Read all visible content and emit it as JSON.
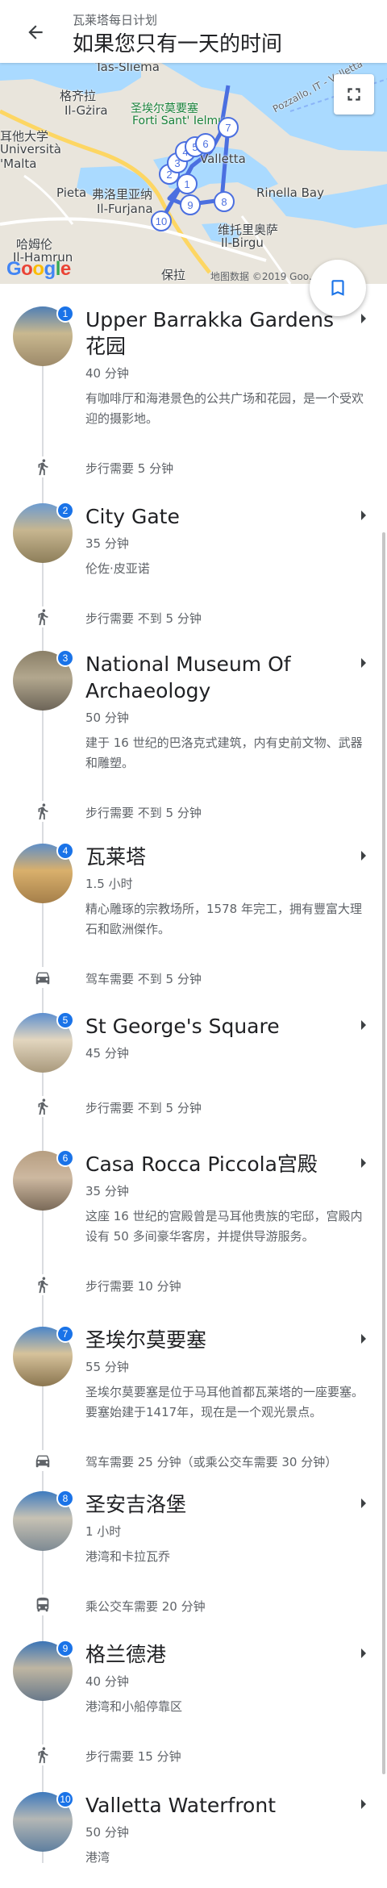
{
  "header": {
    "subtitle": "瓦莱塔每日计划",
    "title": "如果您只有一天的时间"
  },
  "map": {
    "labels": {
      "tas_sliema": "Tas-Sliema",
      "gzira_cn": "格齐拉",
      "gzira": "Il-Gżira",
      "uni_cn": "耳他大学",
      "uni1": "Università",
      "uni2": "'Malta",
      "fort_cn": "圣埃尔莫要塞",
      "fort": "Forti Sant' Ielmu",
      "valletta": "Valletta",
      "pieta": "Pieta",
      "furjana_cn": "弗洛里亚纳",
      "furjana": "Il-Furjana",
      "rinella": "Rinella Bay",
      "birgu_cn": "维托里奥萨",
      "birgu": "Il-Birgu",
      "hamrun_cn": "哈姆伦",
      "hamrun": "Il-Hamrun",
      "paola": "保拉",
      "pozzallo": "Pozzallo, IT - Valletta"
    },
    "markers": [
      "1",
      "2",
      "3",
      "4",
      "5",
      "6",
      "7",
      "8",
      "9",
      "10"
    ],
    "google_logo": "Google",
    "attribution": "地图数据 ©2019 Goo... 款"
  },
  "stops": [
    {
      "num": "1",
      "name": "Upper Barrakka Gardens 花园",
      "duration": "40 分钟",
      "desc": "有咖啡厅和海港景色的公共广场和花园，是一个受欢迎的摄影地。",
      "transit_icon": "walk-icon",
      "transit": "步行需要 5 分钟"
    },
    {
      "num": "2",
      "name": "City Gate",
      "duration": "35 分钟",
      "desc": "伦佐·皮亚诺",
      "transit_icon": "walk-icon",
      "transit": "步行需要 不到 5 分钟"
    },
    {
      "num": "3",
      "name": "National Museum Of Archaeology",
      "duration": "50 分钟",
      "desc": "建于 16 世纪的巴洛克式建筑，内有史前文物、武器和雕塑。",
      "transit_icon": "walk-icon",
      "transit": "步行需要 不到 5 分钟"
    },
    {
      "num": "4",
      "name": "瓦莱塔",
      "duration": "1.5 小时",
      "desc": "精心雕琢的宗教场所，1578 年完工，拥有豐富大理石和歐洲傑作。",
      "transit_icon": "car-icon",
      "transit": "驾车需要 不到 5 分钟"
    },
    {
      "num": "5",
      "name": "St George's Square",
      "duration": "45 分钟",
      "desc": "",
      "transit_icon": "walk-icon",
      "transit": "步行需要 不到 5 分钟"
    },
    {
      "num": "6",
      "name": "Casa Rocca Piccola宫殿",
      "duration": "35 分钟",
      "desc": "这座 16 世纪的宫殿曾是马耳他贵族的宅邸，宫殿内设有 50 多间豪华客房，并提供导游服务。",
      "transit_icon": "walk-icon",
      "transit": "步行需要 10 分钟"
    },
    {
      "num": "7",
      "name": "圣埃尔莫要塞",
      "duration": "55 分钟",
      "desc": "圣埃尔莫要塞是位于马耳他首都瓦莱塔的一座要塞。要塞始建于1417年，现在是一个观光景点。",
      "transit_icon": "car-icon",
      "transit": "驾车需要 25 分钟（或乘公交车需要 30 分钟）"
    },
    {
      "num": "8",
      "name": "圣安吉洛堡",
      "duration": "1 小时",
      "desc": "港湾和卡拉瓦乔",
      "transit_icon": "bus-icon",
      "transit": "乘公交车需要 20 分钟"
    },
    {
      "num": "9",
      "name": "格兰德港",
      "duration": "40 分钟",
      "desc": "港湾和小船停靠区",
      "transit_icon": "walk-icon",
      "transit": "步行需要 15 分钟"
    },
    {
      "num": "10",
      "name": "Valletta Waterfront",
      "duration": "50 分钟",
      "desc": "港湾",
      "transit_icon": "",
      "transit": ""
    }
  ],
  "colors": {
    "accent": "#1a73e8",
    "route": "#4b6fe0",
    "map_land": "#e9e5dc",
    "map_water": "#aadaff"
  }
}
